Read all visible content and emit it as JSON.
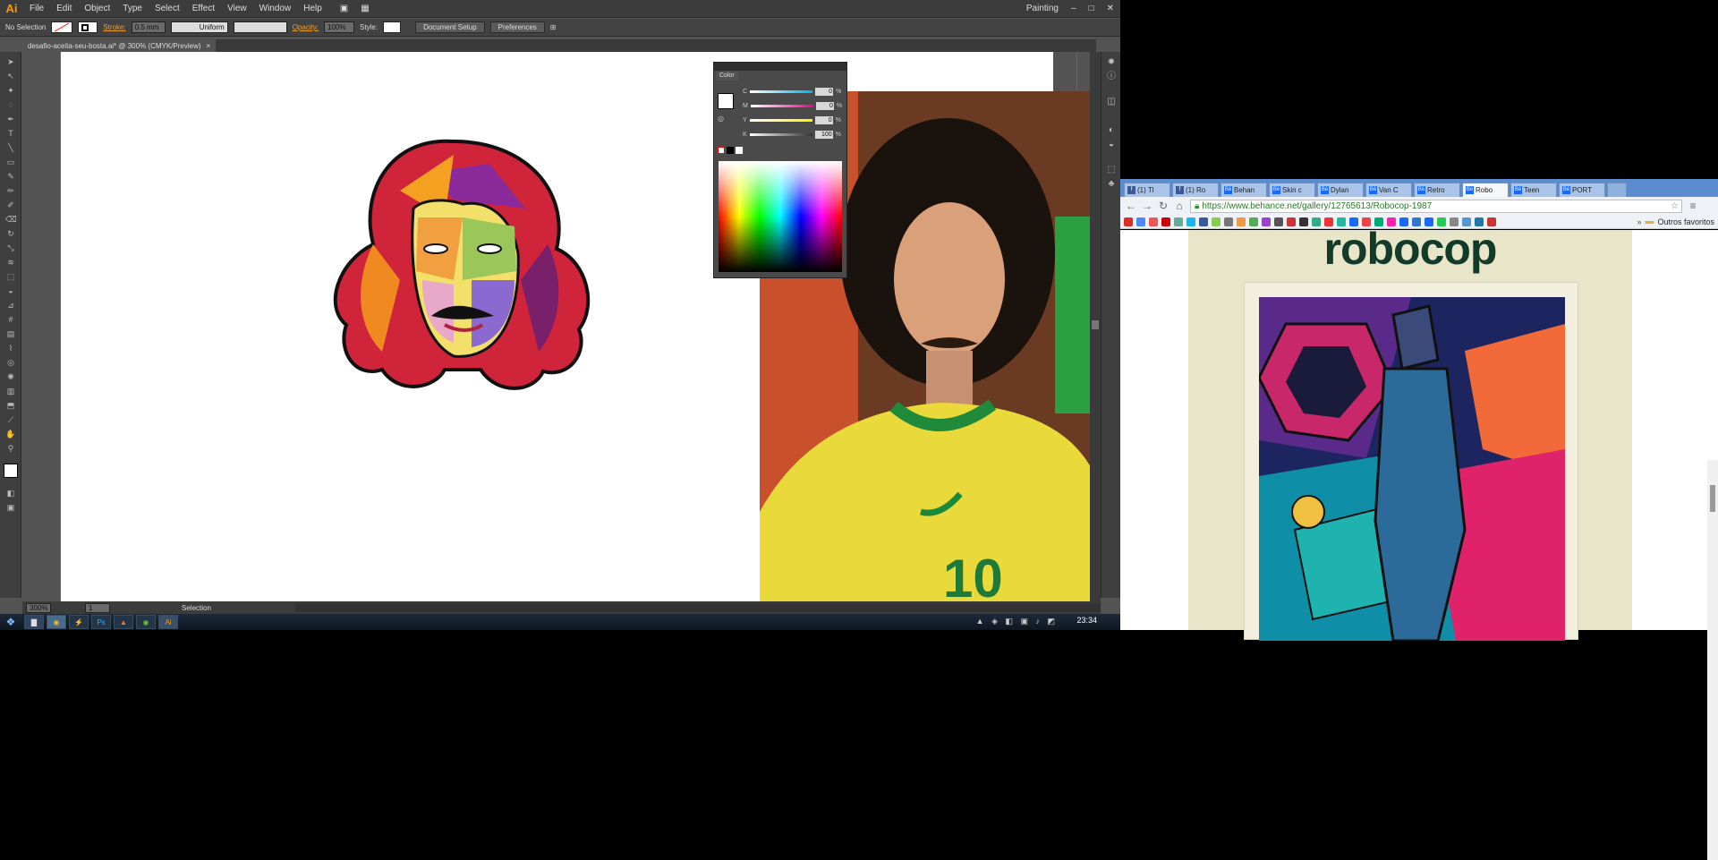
{
  "illustrator": {
    "logo": "Ai",
    "menus": [
      "File",
      "Edit",
      "Object",
      "Type",
      "Select",
      "Effect",
      "View",
      "Window",
      "Help"
    ],
    "workspace": "Painting",
    "control_bar": {
      "selection": "No Selection",
      "stroke_label": "Stroke:",
      "stroke_value": "0.5 mm",
      "profile": "Uniform",
      "opacity_label": "Opacity:",
      "opacity_value": "100%",
      "style_label": "Style:",
      "document_setup": "Document Setup",
      "preferences": "Preferences"
    },
    "doc_tab": "desafio-aceita-seu-bosta.ai* @ 300% (CMYK/Preview)",
    "doc_tab_close": "×",
    "status": {
      "zoom": "300%",
      "page": "1",
      "tool": "Selection"
    },
    "color_panel": {
      "tab": "Color",
      "channels": [
        {
          "label": "C",
          "value": "0"
        },
        {
          "label": "M",
          "value": "0"
        },
        {
          "label": "Y",
          "value": "0"
        },
        {
          "label": "K",
          "value": "100"
        }
      ],
      "percent": "%"
    }
  },
  "taskbar": {
    "apps": [
      "Explorer",
      "Chrome",
      "Winamp",
      "Photoshop",
      "VLC",
      "Illustrator"
    ],
    "clock": "23:34"
  },
  "chrome": {
    "tabs": [
      {
        "label": "(1) Tl",
        "icon": "f"
      },
      {
        "label": "(1) Ro",
        "icon": "f"
      },
      {
        "label": "Behan",
        "icon": "Bē"
      },
      {
        "label": "Skin c",
        "icon": "Bē"
      },
      {
        "label": "Dylan",
        "icon": "Bē"
      },
      {
        "label": "Van C",
        "icon": "Bē"
      },
      {
        "label": "Retro",
        "icon": "Bē"
      },
      {
        "label": "Robo",
        "icon": "Bē"
      },
      {
        "label": "Teen",
        "icon": "Bē"
      },
      {
        "label": "PORT",
        "icon": "Bē"
      }
    ],
    "active_tab": 7,
    "url": "https://www.behance.net/gallery/12765613/Robocop-1987",
    "bookmarks_folder": "Outros favoritos",
    "page_title": "robocop"
  }
}
